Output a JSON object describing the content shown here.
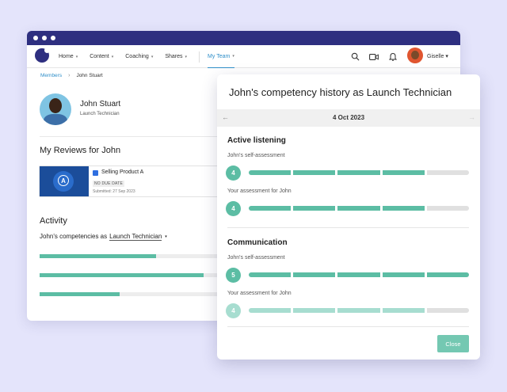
{
  "nav": {
    "items": [
      {
        "label": "Home",
        "caret": "▾"
      },
      {
        "label": "Content",
        "caret": "▾"
      },
      {
        "label": "Coaching",
        "caret": "▾"
      },
      {
        "label": "Shares",
        "caret": "▾"
      }
    ],
    "active": {
      "label": "My Team",
      "caret": "▾"
    },
    "user": "Giselle ▾",
    "icons": [
      "search-icon",
      "video-icon",
      "bell-icon"
    ]
  },
  "breadcrumb": {
    "root": "Members",
    "sep": "›",
    "current": "John Stuart"
  },
  "profile": {
    "name": "John Stuart",
    "role": "Launch Technician"
  },
  "reviews": {
    "heading": "My Reviews for John",
    "card": {
      "title": "Selling Product A",
      "badge": "NO DUE DATE",
      "date": "Submitted: 27 Sep 2023",
      "glyph": "A"
    }
  },
  "activity": {
    "heading": "Activity",
    "prefix": "John's competencies as",
    "role": "Launch Technician",
    "caret": "▾",
    "bars": [
      0.64,
      0.9,
      0.44
    ]
  },
  "modal": {
    "title": "John's competency history as Launch Technician",
    "date": "4 Oct 2023",
    "prev": "←",
    "next": "→",
    "max_score": 5,
    "sections": [
      {
        "title": "Active listening",
        "rows": [
          {
            "label": "John's self-assessment",
            "score": "4"
          },
          {
            "label": "Your assessment for John",
            "score": "4"
          }
        ]
      },
      {
        "title": "Communication",
        "rows": [
          {
            "label": "John's self-assessment",
            "score": "5"
          },
          {
            "label": "Your assessment for John",
            "score": "4"
          }
        ]
      }
    ],
    "close": "Close"
  },
  "colors": {
    "primary": "#2e2f80",
    "accent": "#5cbda4",
    "link": "#2f8fc9"
  }
}
